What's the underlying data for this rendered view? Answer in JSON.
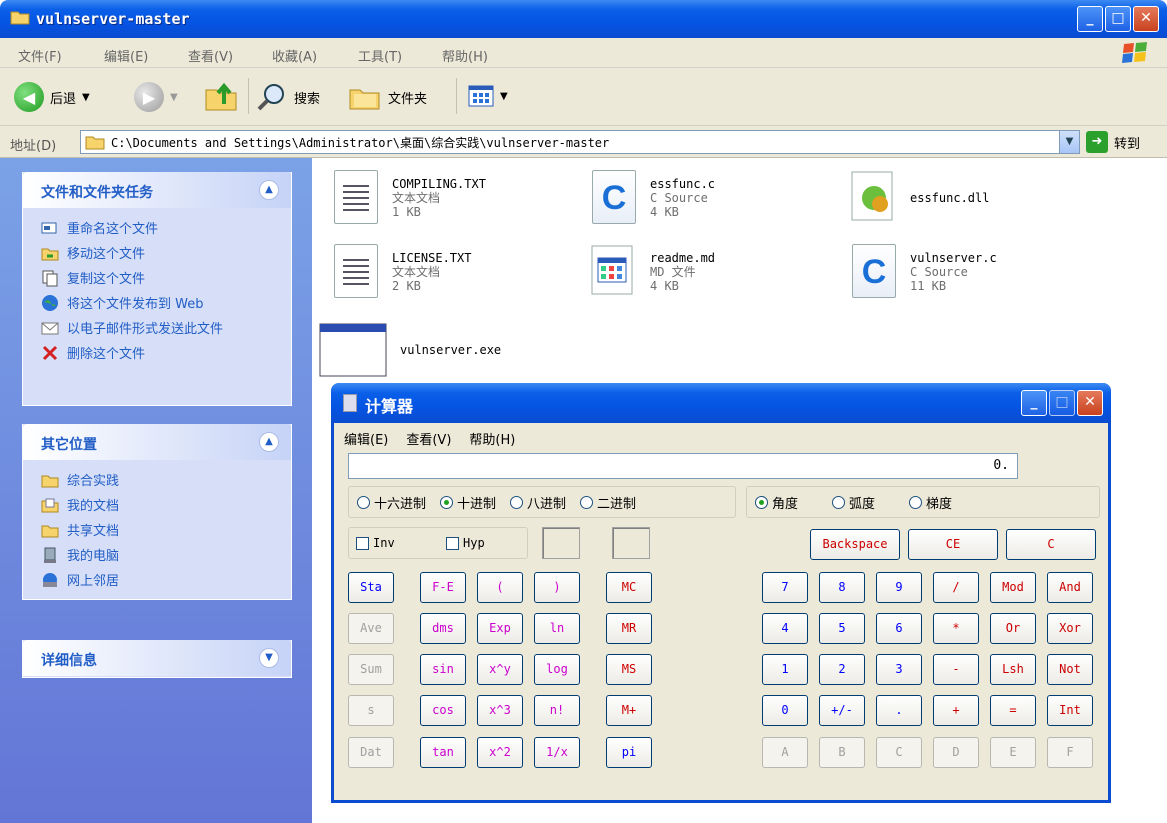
{
  "explorer": {
    "title": "vulnserver-master",
    "menu": [
      "文件(F)",
      "编辑(E)",
      "查看(V)",
      "收藏(A)",
      "工具(T)",
      "帮助(H)"
    ],
    "toolbar": {
      "back": "后退",
      "search": "搜索",
      "folders": "文件夹"
    },
    "address_label": "地址(D)",
    "address": "C:\\Documents and Settings\\Administrator\\桌面\\综合实践\\vulnserver-master",
    "go": "转到"
  },
  "taskpane": {
    "file_tasks": {
      "title": "文件和文件夹任务",
      "items": [
        "重命名这个文件",
        "移动这个文件",
        "复制这个文件",
        "将这个文件发布到 Web",
        "以电子邮件形式发送此文件",
        "删除这个文件"
      ]
    },
    "other_places": {
      "title": "其它位置",
      "items": [
        "综合实践",
        "我的文档",
        "共享文档",
        "我的电脑",
        "网上邻居"
      ]
    },
    "details": {
      "title": "详细信息"
    }
  },
  "files": [
    {
      "name": "COMPILING.TXT",
      "type": "文本文档",
      "size": "1 KB",
      "icon": "text-doc-icon"
    },
    {
      "name": "essfunc.c",
      "type": "C Source",
      "size": "4 KB",
      "icon": "c-source-icon"
    },
    {
      "name": "essfunc.dll",
      "type": "",
      "size": "",
      "icon": "dll-icon"
    },
    {
      "name": "LICENSE.TXT",
      "type": "文本文档",
      "size": "2 KB",
      "icon": "text-doc-icon"
    },
    {
      "name": "readme.md",
      "type": "MD 文件",
      "size": "4 KB",
      "icon": "md-file-icon"
    },
    {
      "name": "vulnserver.c",
      "type": "C Source",
      "size": "11 KB",
      "icon": "c-source-icon"
    },
    {
      "name": "vulnserver.exe",
      "type": "",
      "size": "",
      "icon": "exe-icon"
    }
  ],
  "calculator": {
    "title": "计算器",
    "menu": [
      "编辑(E)",
      "查看(V)",
      "帮助(H)"
    ],
    "display": "0.",
    "bases": [
      "十六进制",
      "十进制",
      "八进制",
      "二进制"
    ],
    "selected_base": "十进制",
    "angles": [
      "角度",
      "弧度",
      "梯度"
    ],
    "selected_angle": "角度",
    "inv": "Inv",
    "hyp": "Hyp",
    "edit_keys": [
      "Backspace",
      "CE",
      "C"
    ],
    "keys": {
      "stat": [
        "Sta",
        "Ave",
        "Sum",
        "s",
        "Dat"
      ],
      "sci1": [
        "F-E",
        "dms",
        "sin",
        "cos",
        "tan"
      ],
      "sci2": [
        "(",
        "Exp",
        "x^y",
        "x^3",
        "x^2"
      ],
      "sci3": [
        ")",
        "ln",
        "log",
        "n!",
        "1/x"
      ],
      "mem": [
        "MC",
        "MR",
        "MS",
        "M+",
        "pi"
      ],
      "num_rows": [
        [
          "7",
          "8",
          "9",
          "/",
          "Mod",
          "And"
        ],
        [
          "4",
          "5",
          "6",
          "*",
          "Or",
          "Xor"
        ],
        [
          "1",
          "2",
          "3",
          "-",
          "Lsh",
          "Not"
        ],
        [
          "0",
          "+/-",
          ".",
          "+",
          "=",
          "Int"
        ],
        [
          "A",
          "B",
          "C",
          "D",
          "E",
          "F"
        ]
      ]
    }
  }
}
